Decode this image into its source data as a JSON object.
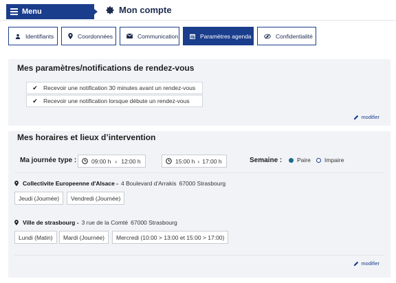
{
  "header": {
    "menu_label": "Menu",
    "title": "Mon compte"
  },
  "tabs": [
    {
      "label": "Identifiants",
      "icon": "user-icon",
      "active": false
    },
    {
      "label": "Coordonnées",
      "icon": "map-pin-icon",
      "active": false
    },
    {
      "label": "Communication",
      "icon": "envelope-icon",
      "active": false
    },
    {
      "label": "Paramètres agenda",
      "icon": "calendar-icon",
      "active": true
    },
    {
      "label": "Confidentialité",
      "icon": "eye-slash-icon",
      "active": false
    }
  ],
  "notifications": {
    "title": "Mes paramètres/notifications de rendez-vous",
    "items": [
      "Recevoir une notification 30 minutes avant un rendez-vous",
      "Recevoir une notification lorsque débute un rendez-vous"
    ],
    "modify_label": "modifier"
  },
  "schedule": {
    "title": "Mes horaires et lieux d’intervention",
    "journee_label": "Ma journée type :",
    "slot1": {
      "start": "09:00 h",
      "end": "12:00 h"
    },
    "slot2": {
      "start": "15:00 h",
      "end": "17:00 h"
    },
    "week_label": "Semaine :",
    "week_options": [
      {
        "label": "Paire",
        "selected": true
      },
      {
        "label": "Impaire",
        "selected": false
      }
    ],
    "locations": [
      {
        "name": "Collectivite Europeenne d'Alsace -",
        "address": "4 Boulevard d'Arrakis",
        "postal": "67000 Strasbourg",
        "days": [
          "Jeudi (Journée)",
          "Vendredi (Journée)"
        ]
      },
      {
        "name": "Ville de strasbourg -",
        "address": "3 rue de la Comté",
        "postal": "67000 Strasbourg",
        "days": [
          "Lundi (Matin)",
          "Mardi (Journée)",
          "Mercredi (10:00 > 13:00 et 15:00 > 17:00)"
        ]
      }
    ],
    "modify_label": "modifier"
  },
  "colors": {
    "primary": "#1a3d8c",
    "panel_bg": "#f1f3f7",
    "radio_selected": "#1b6a8c"
  }
}
